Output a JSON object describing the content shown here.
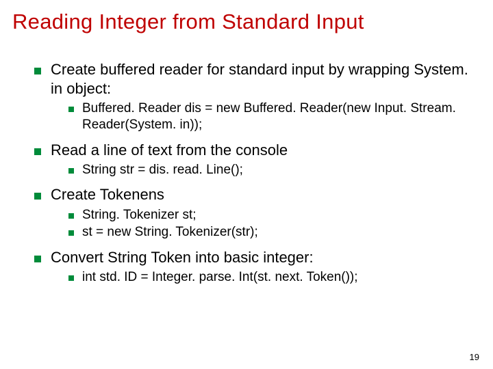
{
  "title": "Reading Integer from Standard Input",
  "items": [
    {
      "text": "Create buffered reader for standard input by wrapping System. in object:",
      "subs": [
        "Buffered. Reader dis = new Buffered. Reader(new Input. Stream. Reader(System. in));"
      ]
    },
    {
      "text": "Read a line of text from the console",
      "subs": [
        "String str = dis. read. Line();"
      ]
    },
    {
      "text": "Create Tokenens",
      "subs": [
        "String. Tokenizer st;",
        "st = new String. Tokenizer(str);"
      ]
    },
    {
      "text": "Convert String Token into basic integer:",
      "subs": [
        "int std. ID = Integer. parse. Int(st. next. Token());"
      ]
    }
  ],
  "pageNumber": "19"
}
